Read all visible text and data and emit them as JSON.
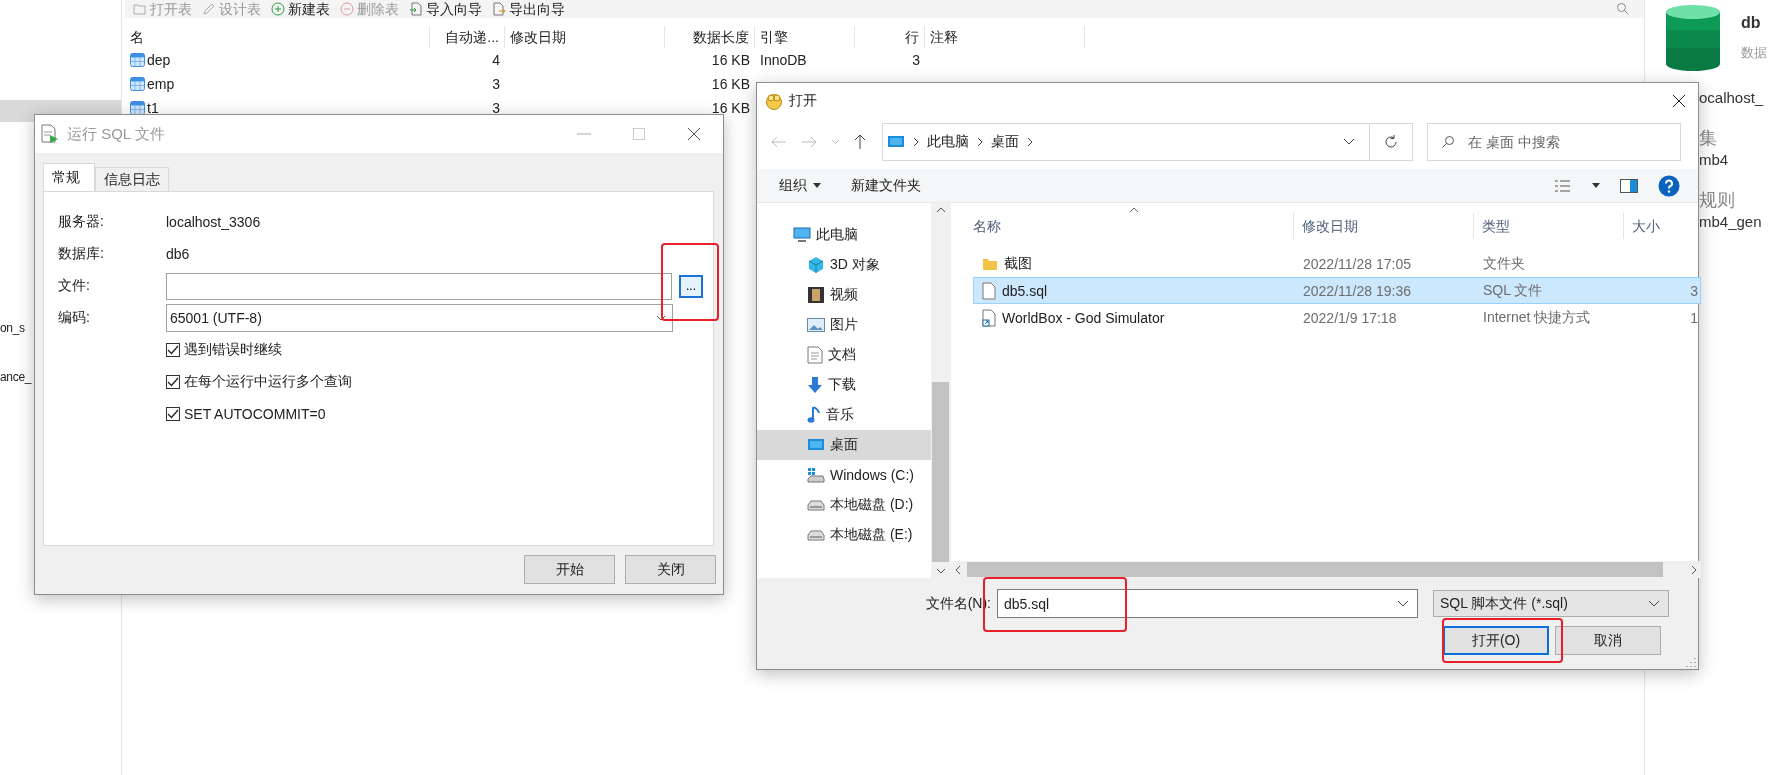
{
  "sidebar": {
    "items": [
      {
        "label": "on_s"
      },
      {
        "label": "ance_"
      }
    ]
  },
  "toolbar": [
    {
      "kind": "open",
      "label": "打开表",
      "disabled": true
    },
    {
      "kind": "design",
      "label": "设计表",
      "disabled": true
    },
    {
      "kind": "new",
      "label": "新建表",
      "disabled": false
    },
    {
      "kind": "delete",
      "label": "删除表",
      "disabled": true
    },
    {
      "kind": "import",
      "label": "导入向导",
      "disabled": false
    },
    {
      "kind": "export",
      "label": "导出向导",
      "disabled": false
    }
  ],
  "table": {
    "columns": [
      "名",
      "自动递...",
      "修改日期",
      "数据长度",
      "引擎",
      "行",
      "注释"
    ],
    "rows": [
      {
        "name": "dep",
        "auto_increment": "4",
        "data_length": "16 KB",
        "engine": "InnoDB",
        "rows": "3"
      },
      {
        "name": "emp",
        "auto_increment": "3",
        "data_length": "16 KB"
      },
      {
        "name": "t1",
        "auto_increment": "3",
        "data_length": "16 KB"
      }
    ]
  },
  "info_panel": {
    "title": "db",
    "subtitle": "数据",
    "lines": [
      "ocalhost_",
      "集",
      "mb4",
      "规则",
      "mb4_gen"
    ]
  },
  "run_sql_dialog": {
    "title": "运行 SQL 文件",
    "tabs": [
      {
        "label": "常规",
        "selected": true
      },
      {
        "label": "信息日志",
        "selected": false
      }
    ],
    "fields": [
      {
        "kind": "text",
        "label": "服务器:",
        "value": "localhost_3306"
      },
      {
        "kind": "text",
        "label": "数据库:",
        "value": "db6"
      },
      {
        "kind": "file",
        "label": "文件:",
        "button": "..."
      },
      {
        "kind": "select",
        "label": "编码:",
        "value": "65001 (UTF-8)"
      }
    ],
    "options": [
      {
        "label": "遇到错误时继续",
        "checked": true
      },
      {
        "label": "在每个运行中运行多个查询",
        "checked": true
      },
      {
        "label": "SET AUTOCOMMIT=0",
        "checked": true
      }
    ],
    "buttons": [
      "开始",
      "关闭"
    ]
  },
  "open_dialog": {
    "title": "打开",
    "path": [
      "此电脑",
      "桌面"
    ],
    "search": {
      "placeholder": "在 桌面 中搜索"
    },
    "toolbar": [
      {
        "kind": "menu",
        "label": "组织"
      },
      {
        "kind": "button",
        "label": "新建文件夹"
      }
    ],
    "nav": [
      {
        "kind": "pc",
        "label": "此电脑",
        "selected": false,
        "children": [
          {
            "kind": "cube",
            "label": "3D 对象",
            "selected": false
          },
          {
            "kind": "video",
            "label": "视频",
            "selected": false
          },
          {
            "kind": "picture",
            "label": "图片",
            "selected": false
          },
          {
            "kind": "document",
            "label": "文档",
            "selected": false
          },
          {
            "kind": "download",
            "label": "下载",
            "selected": false
          },
          {
            "kind": "music",
            "label": "音乐",
            "selected": false
          },
          {
            "kind": "desktop",
            "label": "桌面",
            "selected": true
          },
          {
            "kind": "windows-drive",
            "label": "Windows (C:)",
            "selected": false
          },
          {
            "kind": "drive",
            "label": "本地磁盘 (D:)",
            "selected": false
          },
          {
            "kind": "drive",
            "label": "本地磁盘 (E:)",
            "selected": false
          }
        ]
      }
    ],
    "columns": [
      "名称",
      "修改日期",
      "类型",
      "大小"
    ],
    "files": [
      {
        "kind": "folder",
        "name": "截图",
        "modified": "2022/11/28 17:05",
        "type": "文件夹",
        "selected": false
      },
      {
        "kind": "file",
        "name": "db5.sql",
        "modified": "2022/11/28 19:36",
        "type": "SQL 文件",
        "size": "3",
        "selected": true
      },
      {
        "kind": "shortcut",
        "name": "WorldBox - God Simulator",
        "modified": "2022/1/9 17:18",
        "type": "Internet 快捷方式",
        "size": "1",
        "selected": false
      }
    ],
    "filename": {
      "label": "文件名(N):",
      "value": "db5.sql"
    },
    "filter": "SQL 脚本文件 (*.sql)",
    "buttons": [
      {
        "label": "打开(O)",
        "default": true
      },
      {
        "label": "取消",
        "default": false
      }
    ]
  }
}
